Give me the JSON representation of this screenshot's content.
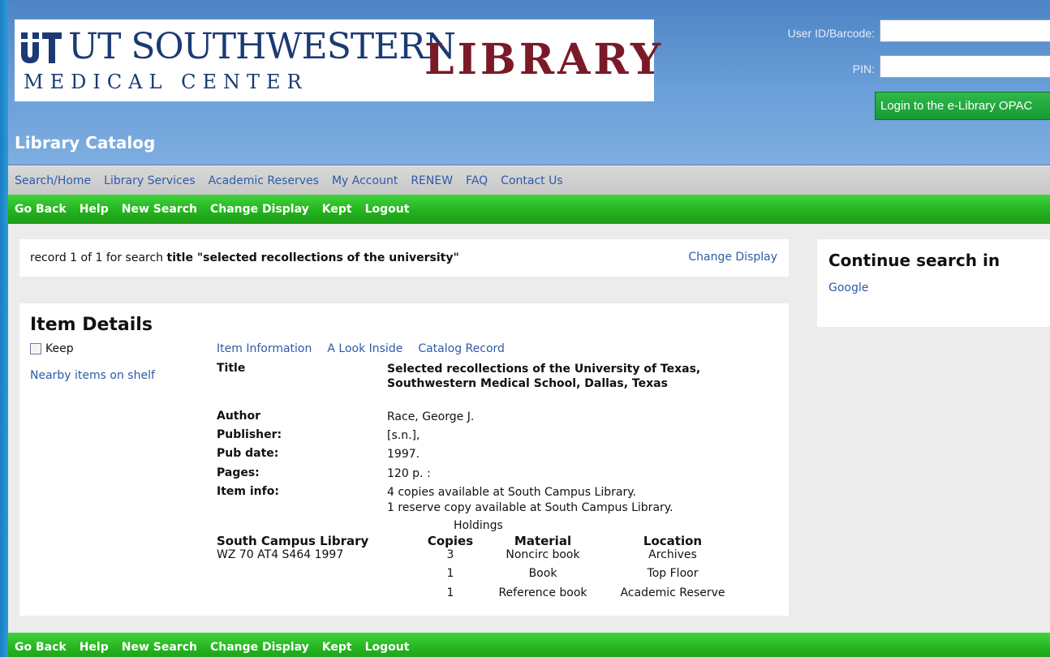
{
  "header": {
    "logo_utsw": "UT SOUTHWESTERN",
    "logo_medical_center": "MEDICAL CENTER",
    "logo_library": "LIBRARY",
    "catalog_title": "Library Catalog"
  },
  "login": {
    "user_label": "User ID/Barcode:",
    "user_value": "",
    "pin_label": "PIN:",
    "pin_value": "",
    "button_label": "Login to the e-Library OPAC"
  },
  "main_nav": [
    "Search/Home",
    "Library Services",
    "Academic Reserves",
    "My Account",
    "RENEW",
    "FAQ",
    "Contact Us"
  ],
  "action_bar": [
    "Go Back",
    "Help",
    "New Search",
    "Change Display",
    "Kept",
    "Logout"
  ],
  "search_summary": {
    "prefix": "record 1 of 1 for search ",
    "field": "title",
    "query": "\"selected recollections of the university\"",
    "change_display": "Change Display"
  },
  "continue_panel": {
    "heading": "Continue search in",
    "link": "Google"
  },
  "item": {
    "heading": "Item Details",
    "keep_label": "Keep",
    "nearby_link": "Nearby items on shelf",
    "tabs": [
      "Item Information",
      "A Look Inside",
      "Catalog Record"
    ],
    "fields": {
      "title_label": "Title",
      "title_value": "Selected recollections of the University of Texas, Southwestern Medical School, Dallas, Texas",
      "author_label": "Author",
      "author_value": "Race, George J.",
      "publisher_label": "Publisher:",
      "publisher_value": "[s.n.],",
      "pubdate_label": "Pub date:",
      "pubdate_value": "1997.",
      "pages_label": "Pages:",
      "pages_value": "120 p. :",
      "iteminfo_label": "Item info:",
      "iteminfo_line1": "4 copies available at South Campus Library.",
      "iteminfo_line2": "1 reserve copy available at South Campus Library."
    },
    "holdings": {
      "caption": "Holdings",
      "library": "South Campus Library",
      "call_number": "WZ 70 AT4 S464 1997",
      "columns": [
        "Copies",
        "Material",
        "Location"
      ],
      "rows": [
        {
          "copies": "3",
          "material": "Noncirc book",
          "location": "Archives"
        },
        {
          "copies": "1",
          "material": "Book",
          "location": "Top Floor"
        },
        {
          "copies": "1",
          "material": "Reference book",
          "location": "Academic Reserve"
        }
      ]
    }
  }
}
